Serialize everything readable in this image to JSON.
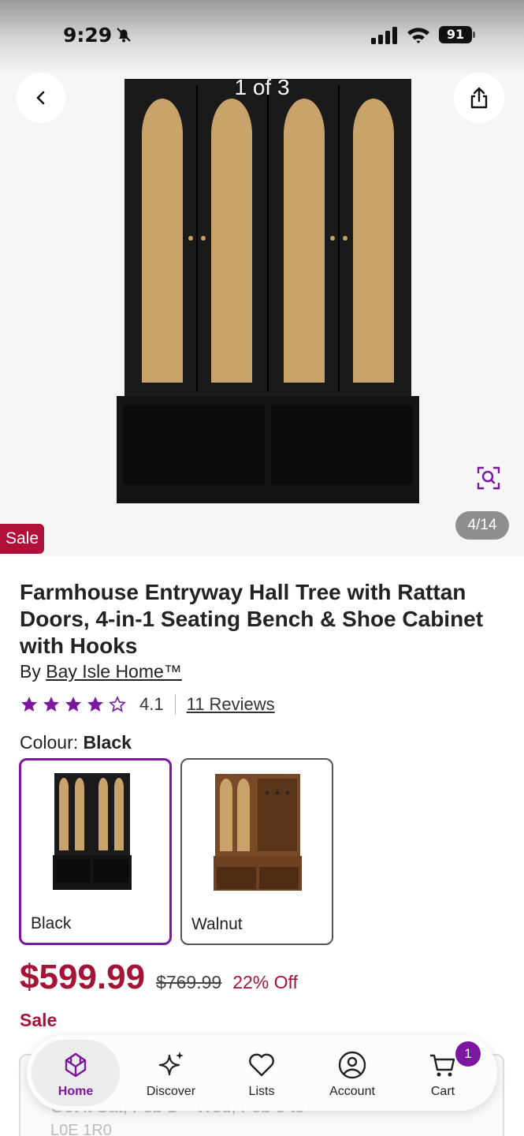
{
  "status_bar": {
    "time": "9:29",
    "battery": "91"
  },
  "gallery": {
    "counter": "1 of 3",
    "page_indicator": "4/14",
    "sale_tag": "Sale"
  },
  "product": {
    "title": "Farmhouse Entryway Hall Tree with Rattan Doors, 4-in-1 Seating Bench & Shoe Cabinet with Hooks",
    "by_prefix": "By",
    "brand": "Bay Isle Home™",
    "rating": 4.1,
    "rating_text": "4.1",
    "reviews": "11 Reviews",
    "colour_label": "Colour:",
    "colour_value": "Black",
    "swatches": [
      {
        "label": "Black",
        "selected": true
      },
      {
        "label": "Walnut",
        "selected": false
      }
    ],
    "price": "$599.99",
    "was_price": "$769.99",
    "discount": "22% Off",
    "sale_label": "Sale"
  },
  "delivery": {
    "text": "Get it Sat, Feb 1 – Wed, Feb 5 to",
    "postal": "L0E 1R0"
  },
  "nav": {
    "items": [
      {
        "label": "Home",
        "icon": "home-icon",
        "active": true
      },
      {
        "label": "Discover",
        "icon": "sparkle-icon",
        "active": false
      },
      {
        "label": "Lists",
        "icon": "heart-icon",
        "active": false
      },
      {
        "label": "Account",
        "icon": "account-icon",
        "active": false
      },
      {
        "label": "Cart",
        "icon": "cart-icon",
        "active": false
      }
    ],
    "cart_count": "1"
  },
  "colors": {
    "accent": "#7b189f",
    "sale": "#a51436",
    "sale_tag": "#b0103a"
  }
}
